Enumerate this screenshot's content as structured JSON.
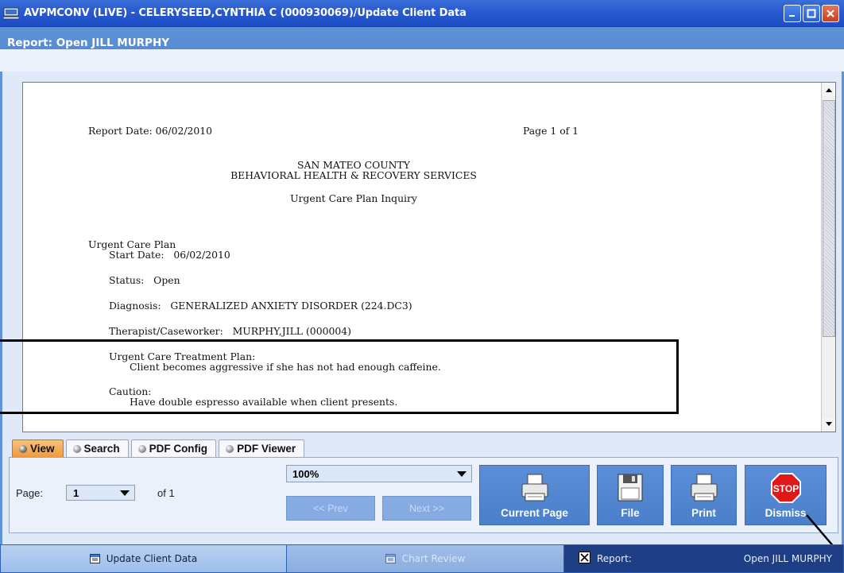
{
  "window": {
    "title": "AVPMCONV (LIVE) - CELERYSEED,CYNTHIA C (000930069)/Update Client Data"
  },
  "report_header": {
    "title": "Report: Open JILL MURPHY"
  },
  "report": {
    "report_date": "Report Date: 06/02/2010",
    "page_info": "Page 1 of 1",
    "county": "SAN MATEO COUNTY",
    "department": "BEHAVIORAL HEALTH & RECOVERY SERVICES",
    "report_name": "Urgent Care Plan Inquiry",
    "section_title": "Urgent Care Plan",
    "start_date": "Start Date:   06/02/2010",
    "status": "Status:   Open",
    "diagnosis": "Diagnosis:   GENERALIZED ANXIETY DISORDER (224.DC3)",
    "therapist": "Therapist/Caseworker:   MURPHY,JILL (000004)",
    "treatment_plan_label": "Urgent Care Treatment Plan:",
    "treatment_plan_text": "Client becomes aggressive if she has not had enough caffeine.",
    "caution_label": "Caution:",
    "caution_text": "Have double espresso available when client presents."
  },
  "tabs": [
    {
      "label": "View",
      "active": true
    },
    {
      "label": "Search",
      "active": false
    },
    {
      "label": "PDF Config",
      "active": false
    },
    {
      "label": "PDF Viewer",
      "active": false
    }
  ],
  "controls": {
    "page_label": "Page:",
    "page_value": "1",
    "of_label": "of 1",
    "zoom_value": "100%",
    "prev_label": "<< Prev",
    "next_label": "Next >>",
    "current_page_label": "Current Page",
    "file_label": "File",
    "print_label": "Print",
    "dismiss_label": "Dismiss",
    "stop_text": "STOP"
  },
  "taskbar": {
    "update_client_data": "Update Client Data",
    "chart_review": "Chart Review",
    "report_label": "Report:",
    "report_name": "Open JILL MURPHY"
  },
  "colors": {
    "title_bar": "#2a5bd0",
    "active_tab": "#ef9a3e",
    "action_button": "#4b7fc9",
    "taskbar_active": "#1e3f85"
  }
}
